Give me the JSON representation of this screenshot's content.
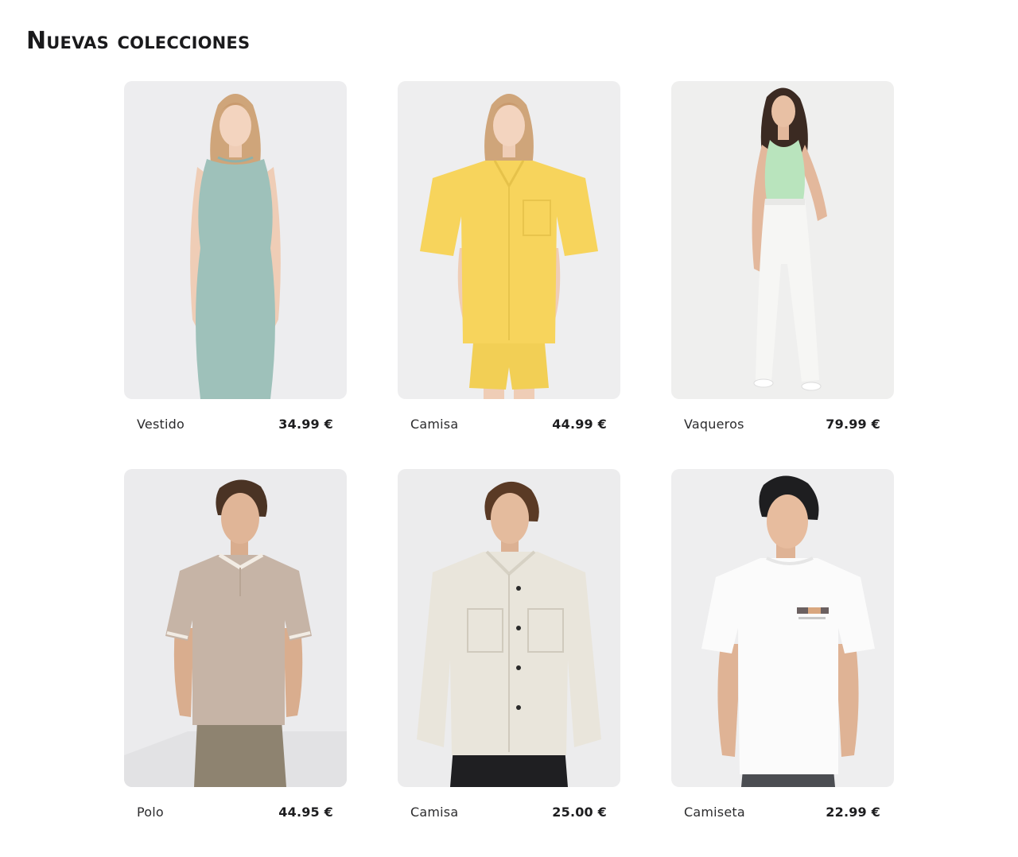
{
  "page": {
    "title": "Nuevas colecciones"
  },
  "products": [
    {
      "name": "Vestido",
      "price": "34.99 €",
      "garment_color": "#9ec1ba",
      "image": "woman-sleeveless-dress"
    },
    {
      "name": "Camisa",
      "price": "44.99 €",
      "garment_color": "#f7d45c",
      "image": "woman-shirt-and-shorts"
    },
    {
      "name": "Vaqueros",
      "price": "79.99 €",
      "garment_color": "#f4f4f2",
      "image": "woman-white-jeans"
    },
    {
      "name": "Polo",
      "price": "44.95 €",
      "garment_color": "#c6b4a6",
      "image": "man-polo-shirt"
    },
    {
      "name": "Camisa",
      "price": "25.00 €",
      "garment_color": "#e9e5db",
      "image": "man-overshirt"
    },
    {
      "name": "Camiseta",
      "price": "22.99 €",
      "garment_color": "#fbfbfb",
      "image": "man-tshirt"
    }
  ],
  "colors": {
    "card_background": "#ececee",
    "text": "#1d1d1f"
  }
}
